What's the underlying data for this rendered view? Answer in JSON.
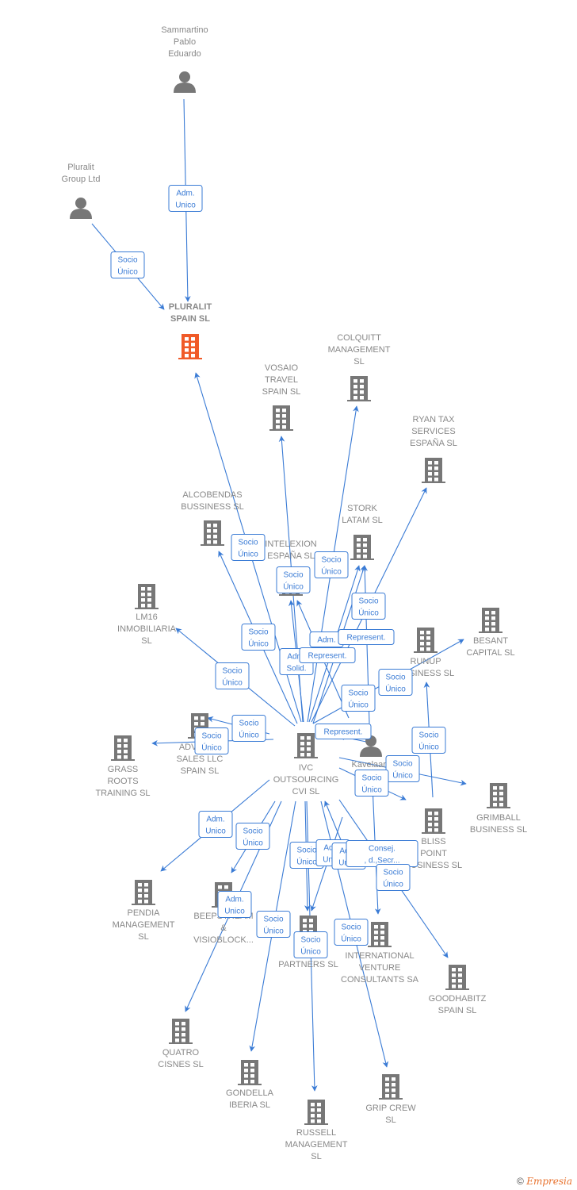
{
  "colors": {
    "edge": "#3a7bd5",
    "node": "#777777",
    "highlight": "#f05a28",
    "label": "#888888"
  },
  "nodes": [
    {
      "id": "sammartino",
      "type": "person",
      "label": [
        "Sammartino",
        "Pablo",
        "Eduardo"
      ]
    },
    {
      "id": "pluralit-group",
      "type": "person",
      "label": [
        "Pluralit",
        "Group Ltd"
      ]
    },
    {
      "id": "pluralit-spain",
      "type": "company",
      "highlight": true,
      "label": [
        "PLURALIT",
        "SPAIN  SL"
      ]
    },
    {
      "id": "colquitt",
      "type": "company",
      "label": [
        "COLQUITT",
        "MANAGEMENT",
        "SL"
      ]
    },
    {
      "id": "vosaio",
      "type": "company",
      "label": [
        "VOSAIO",
        "TRAVEL",
        "SPAIN  SL"
      ]
    },
    {
      "id": "ryan-tax",
      "type": "company",
      "label": [
        "RYAN TAX",
        "SERVICES",
        "ESPAÑA  SL"
      ]
    },
    {
      "id": "alcobendas",
      "type": "company",
      "label": [
        "ALCOBENDAS",
        "BUSSINESS  SL"
      ]
    },
    {
      "id": "stork",
      "type": "company",
      "label": [
        "STORK",
        "LATAM  SL"
      ]
    },
    {
      "id": "intelexion",
      "type": "company",
      "label": [
        "INTELEXION",
        "ESPAÑA SL"
      ]
    },
    {
      "id": "lm16",
      "type": "company",
      "label": [
        "LM16",
        "INMOBILIARIA",
        "SL"
      ]
    },
    {
      "id": "besant",
      "type": "company",
      "label": [
        "BESANT",
        "CAPITAL  SL"
      ]
    },
    {
      "id": "runup",
      "type": "company",
      "label": [
        "RUNUP",
        "BUSINESS  SL"
      ]
    },
    {
      "id": "ivc",
      "type": "company",
      "label": [
        "IVC",
        "OUTSOURCING",
        "CVI SL"
      ]
    },
    {
      "id": "advance",
      "type": "company",
      "label": [
        "ADVANCE",
        "SALES LLC",
        "SPAIN  SL"
      ]
    },
    {
      "id": "grass-roots",
      "type": "company",
      "label": [
        "GRASS",
        "ROOTS",
        "TRAINING  SL"
      ]
    },
    {
      "id": "kavelaars",
      "type": "person",
      "label": [
        "Kavelaars",
        "M          k"
      ]
    },
    {
      "id": "grimball",
      "type": "company",
      "label": [
        "GRIMBALL",
        "BUSINESS  SL"
      ]
    },
    {
      "id": "bliss",
      "type": "company",
      "label": [
        "BLISS",
        "POINT",
        "BUSINESS  SL"
      ]
    },
    {
      "id": "pendia",
      "type": "company",
      "label": [
        "PENDIA",
        "MANAGEMENT",
        "SL"
      ]
    },
    {
      "id": "beepstream",
      "type": "company",
      "label": [
        "BEEPSTREAM",
        "&",
        "VISIOBLOCK..."
      ]
    },
    {
      "id": "sw-b",
      "type": "company",
      "label": [
        "SW          B",
        "PARTNERS  SL"
      ]
    },
    {
      "id": "international",
      "type": "company",
      "label": [
        "INTERNATIONAL",
        "VENTURE",
        "CONSULTANTS SA"
      ]
    },
    {
      "id": "goodhabitz",
      "type": "company",
      "label": [
        "GOODHABITZ",
        "SPAIN  SL"
      ]
    },
    {
      "id": "quatro",
      "type": "company",
      "label": [
        "QUATRO",
        "CISNES  SL"
      ]
    },
    {
      "id": "gondella",
      "type": "company",
      "label": [
        "GONDELLA",
        "IBERIA  SL"
      ]
    },
    {
      "id": "grip-crew",
      "type": "company",
      "label": [
        "GRIP CREW",
        "SL"
      ]
    },
    {
      "id": "russell",
      "type": "company",
      "label": [
        "RUSSELL",
        "MANAGEMENT",
        "SL"
      ]
    }
  ],
  "edges": [
    {
      "from": "sammartino",
      "to": "pluralit-spain",
      "label": "Adm. Unico"
    },
    {
      "from": "pluralit-group",
      "to": "pluralit-spain",
      "label": "Socio Único"
    },
    {
      "from": "ivc",
      "to": "pluralit-spain",
      "label": "Socio Único"
    },
    {
      "from": "ivc",
      "to": "vosaio",
      "label": "Socio Único"
    },
    {
      "from": "ivc",
      "to": "colquitt",
      "label": "Socio Único"
    },
    {
      "from": "ivc",
      "to": "ryan-tax",
      "label": "Socio Único"
    },
    {
      "from": "ivc",
      "to": "alcobendas",
      "label": "Socio Único"
    },
    {
      "from": "ivc",
      "to": "intelexion",
      "label": "Adm. Solid."
    },
    {
      "from": "ivc",
      "to": "stork",
      "label": "Adm."
    },
    {
      "from": "kavelaars",
      "to": "intelexion",
      "label": "Represent."
    },
    {
      "from": "kavelaars",
      "to": "stork",
      "label": "Represent."
    },
    {
      "from": "ivc",
      "to": "stork",
      "label": "Socio Único"
    },
    {
      "from": "ivc",
      "to": "besant",
      "label": "Socio Único"
    },
    {
      "from": "ivc",
      "to": "runup",
      "label": "Socio Único"
    },
    {
      "from": "ivc",
      "to": "lm16",
      "label": "Socio Único"
    },
    {
      "from": "ivc",
      "to": "advance",
      "label": "Socio Único"
    },
    {
      "from": "ivc",
      "to": "grass-roots",
      "label": "Socio Único"
    },
    {
      "from": "kavelaars",
      "to": "ivc",
      "label": "Represent."
    },
    {
      "from": "ivc",
      "to": "grimball",
      "label": "Socio Único"
    },
    {
      "from": "ivc",
      "to": "bliss",
      "label": "Socio Único"
    },
    {
      "from": "ivc",
      "to": "pendia",
      "label": "Adm. Unico"
    },
    {
      "from": "ivc",
      "to": "beepstream",
      "label": "Socio Único"
    },
    {
      "from": "ivc",
      "to": "quatro",
      "label": "Adm. Unico"
    },
    {
      "from": "ivc",
      "to": "gondella",
      "label": "Socio Único"
    },
    {
      "from": "ivc",
      "to": "russell",
      "label": "Socio Único"
    },
    {
      "from": "ivc",
      "to": "sw-b",
      "label": "Socio Único"
    },
    {
      "from": "kavelaars",
      "to": "sw-b",
      "label": "Adm. Unico"
    },
    {
      "from": "kavelaars",
      "to": "ivc",
      "label": "Adm. Unico"
    },
    {
      "from": "kavelaars",
      "to": "international",
      "label": "Consej. , d.,Secr..."
    },
    {
      "from": "ivc",
      "to": "goodhabitz",
      "label": "Socio Único"
    },
    {
      "from": "ivc",
      "to": "grip-crew",
      "label": "Socio Único"
    }
  ],
  "footer": {
    "copyright": "©",
    "brand": "Empresia"
  }
}
